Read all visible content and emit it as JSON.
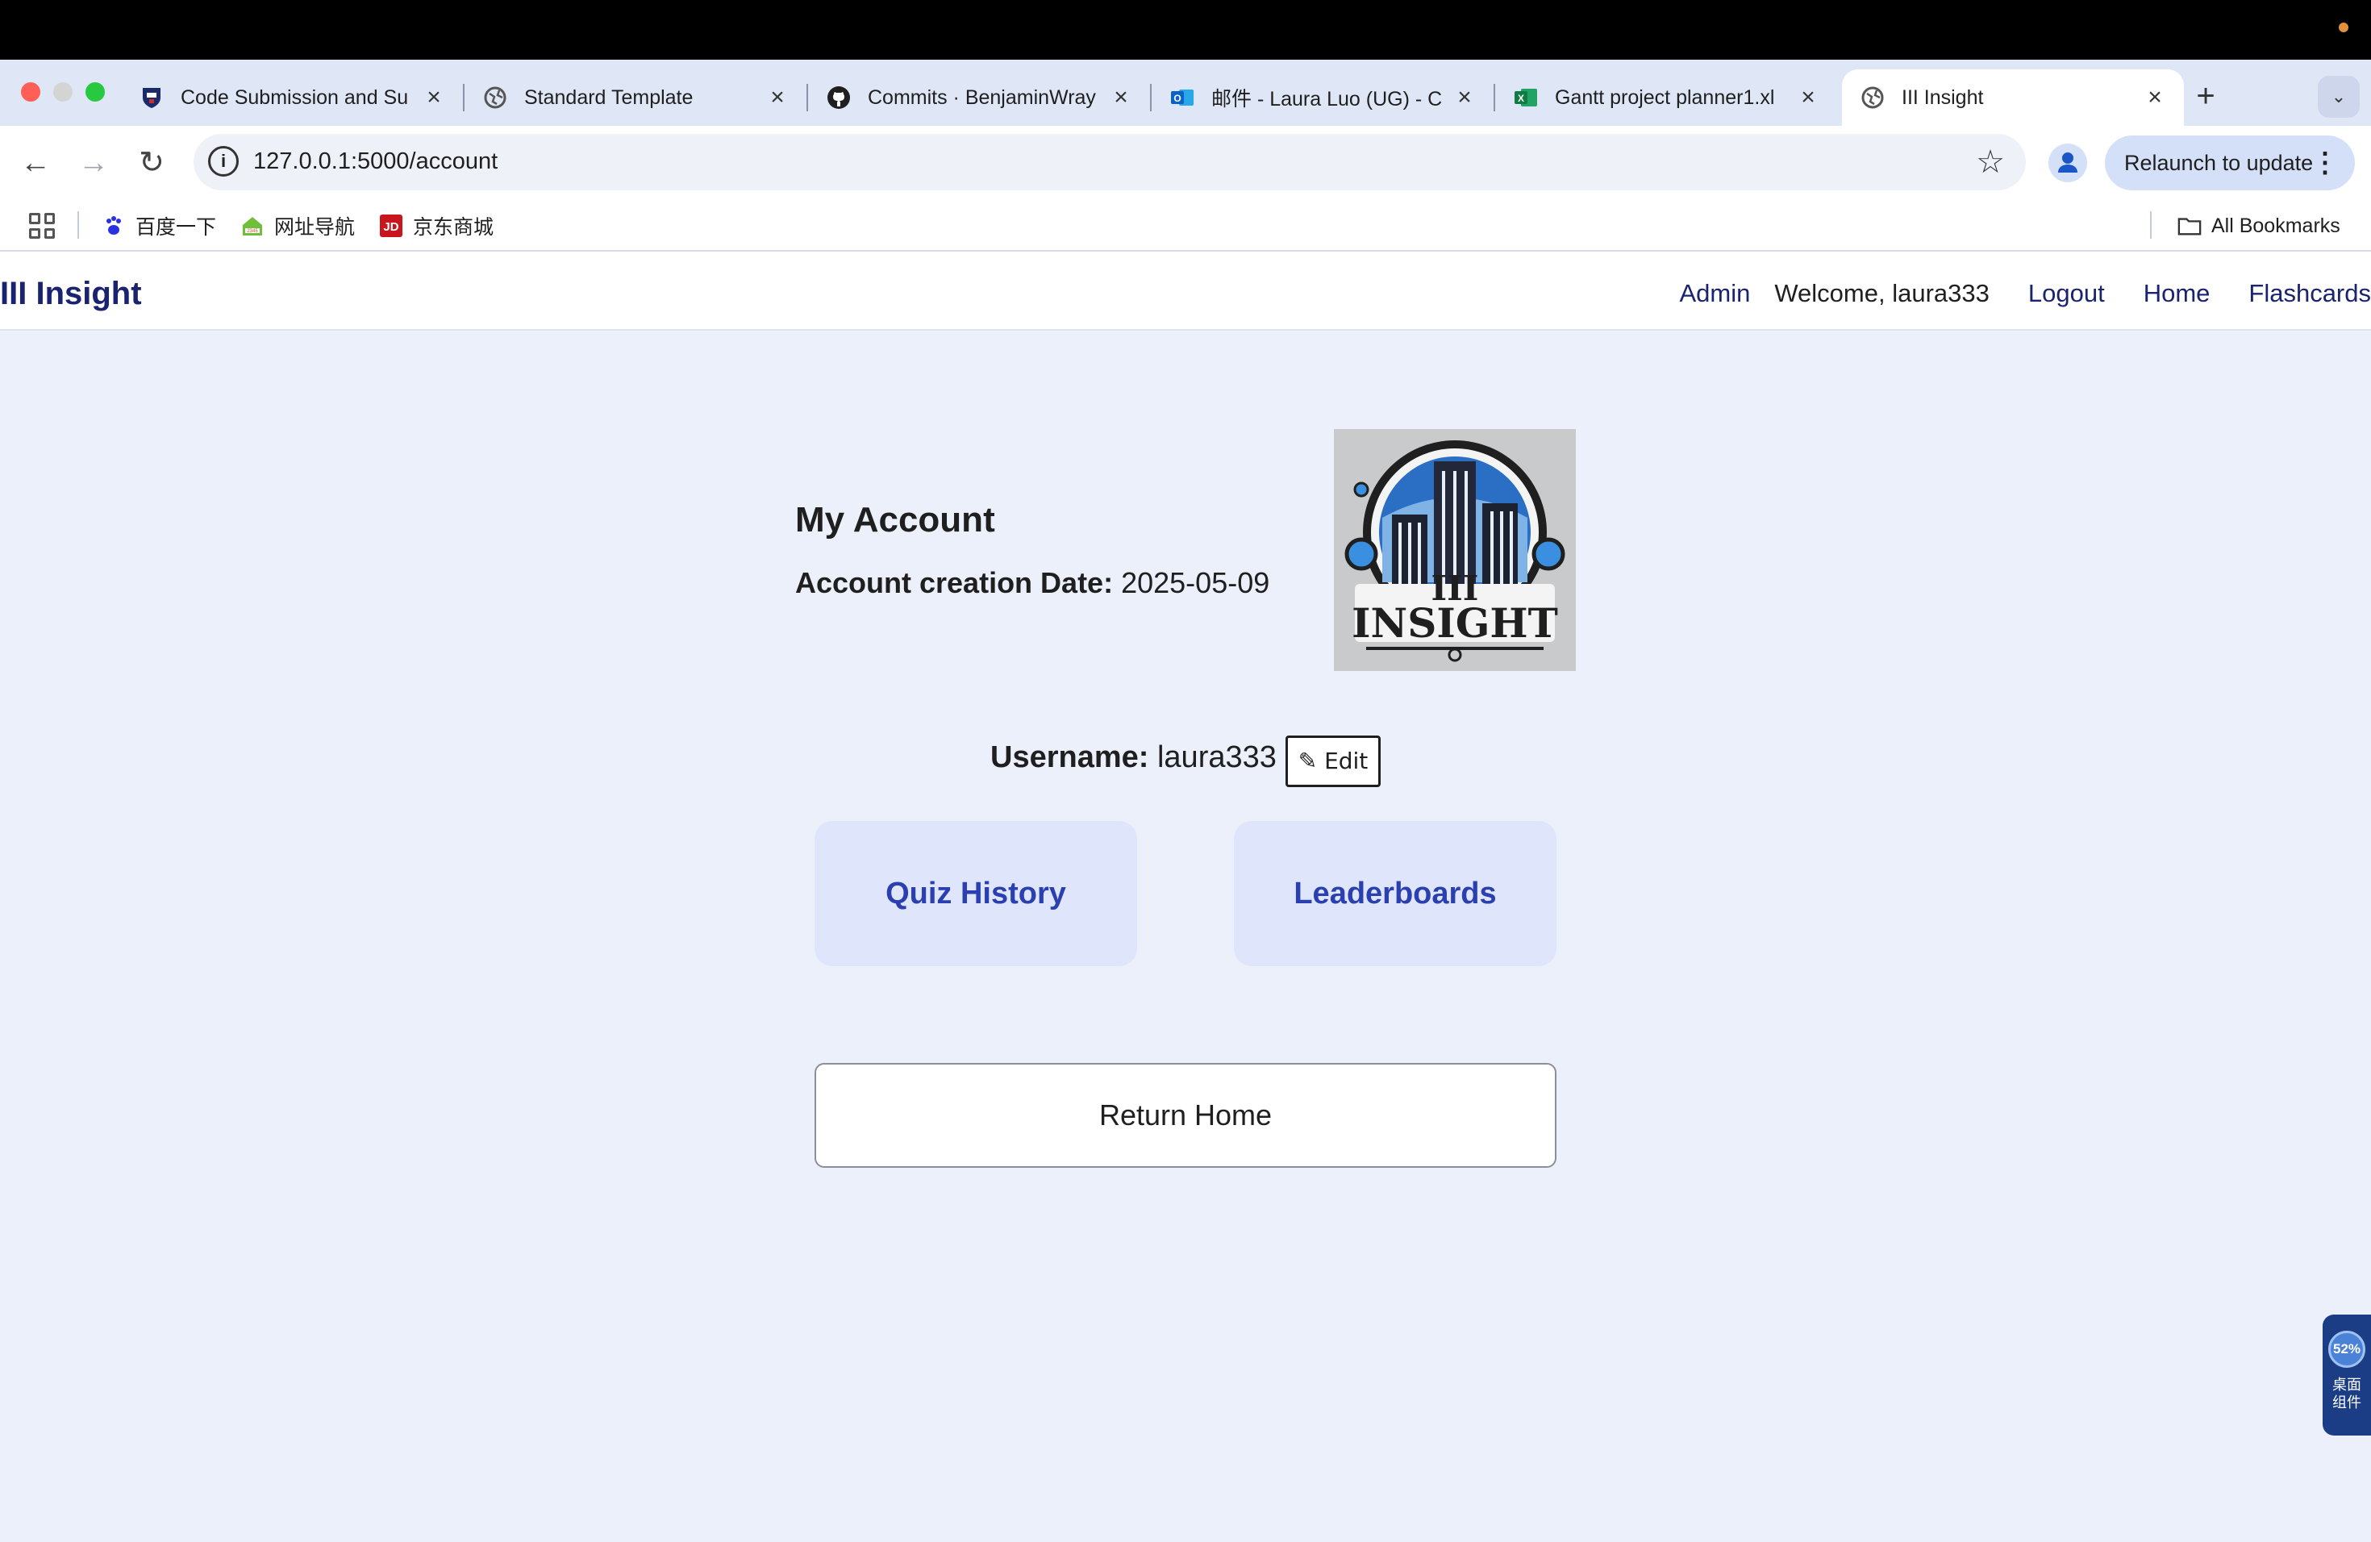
{
  "browser": {
    "tabs": [
      {
        "title": "Code Submission and Su",
        "favicon": "shield-crest-icon"
      },
      {
        "title": "Standard Template",
        "favicon": "globe-icon"
      },
      {
        "title": "Commits · BenjaminWray",
        "favicon": "github-icon"
      },
      {
        "title": "邮件 - Laura Luo (UG) - C",
        "favicon": "outlook-icon"
      },
      {
        "title": "Gantt project planner1.xl",
        "favicon": "excel-icon"
      },
      {
        "title": "III Insight",
        "favicon": "globe-icon",
        "active": true
      }
    ],
    "url": "127.0.0.1:5000/account",
    "relaunch_label": "Relaunch to update",
    "bookmarks": [
      {
        "label": "百度一下",
        "icon": "baidu-paw-icon"
      },
      {
        "label": "网址导航",
        "icon": "nav-house-icon"
      },
      {
        "label": "京东商城",
        "icon": "jd-icon"
      }
    ],
    "all_bookmarks_label": "All Bookmarks"
  },
  "header": {
    "brand": "III Insight",
    "admin_label": "Admin",
    "welcome_text": "Welcome, laura333",
    "logout_label": "Logout",
    "home_label": "Home",
    "flashcards_label": "Flashcards"
  },
  "account": {
    "title": "My Account",
    "creation_label": "Account creation Date:",
    "creation_date": "2025-05-09",
    "logo_text": "INSIGHT",
    "logo_mark": "III",
    "username_label": "Username:",
    "username": "laura333",
    "edit_label": "✎ Edit",
    "quiz_history_label": "Quiz History",
    "leaderboards_label": "Leaderboards",
    "return_home_label": "Return Home"
  },
  "widget": {
    "percent": "52%",
    "label": "桌面组件"
  },
  "colors": {
    "brand_navy": "#1a2370",
    "card_bg": "#dfe6fb",
    "card_text": "#2a3fb0",
    "page_bg": "#ecf0fb"
  }
}
